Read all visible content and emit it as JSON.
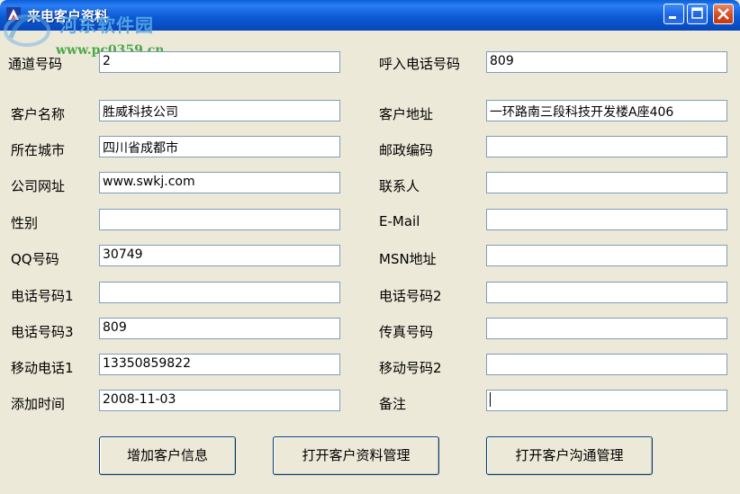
{
  "window": {
    "title": "来电客户资料",
    "watermark_name": "河东软件园",
    "watermark_url": "www.pc0359.cn"
  },
  "form": {
    "left": [
      {
        "label": "通道号码",
        "value": "2"
      },
      {
        "label": "客户名称",
        "value": "胜威科技公司"
      },
      {
        "label": "所在城市",
        "value": "四川省成都市"
      },
      {
        "label": "公司网址",
        "value": "www.swkj.com"
      },
      {
        "label": "性别",
        "value": ""
      },
      {
        "label": "QQ号码",
        "value": "30749"
      },
      {
        "label": "电话号码1",
        "value": ""
      },
      {
        "label": "电话号码3",
        "value": "809"
      },
      {
        "label": "移动电话1",
        "value": "13350859822"
      },
      {
        "label": "添加时间",
        "value": "2008-11-03"
      }
    ],
    "right": [
      {
        "label": "呼入电话号码",
        "value": "809"
      },
      {
        "label": "客户地址",
        "value": "一环路南三段科技开发楼A座406"
      },
      {
        "label": "邮政编码",
        "value": ""
      },
      {
        "label": "联系人",
        "value": ""
      },
      {
        "label": "E-Mail",
        "value": ""
      },
      {
        "label": "MSN地址",
        "value": ""
      },
      {
        "label": "电话号码2",
        "value": ""
      },
      {
        "label": "传真号码",
        "value": ""
      },
      {
        "label": "移动号码2",
        "value": ""
      },
      {
        "label": "备注",
        "value": ""
      }
    ]
  },
  "buttons": {
    "add": "增加客户信息",
    "open_data": "打开客户资料管理",
    "open_comm": "打开客户沟通管理"
  }
}
